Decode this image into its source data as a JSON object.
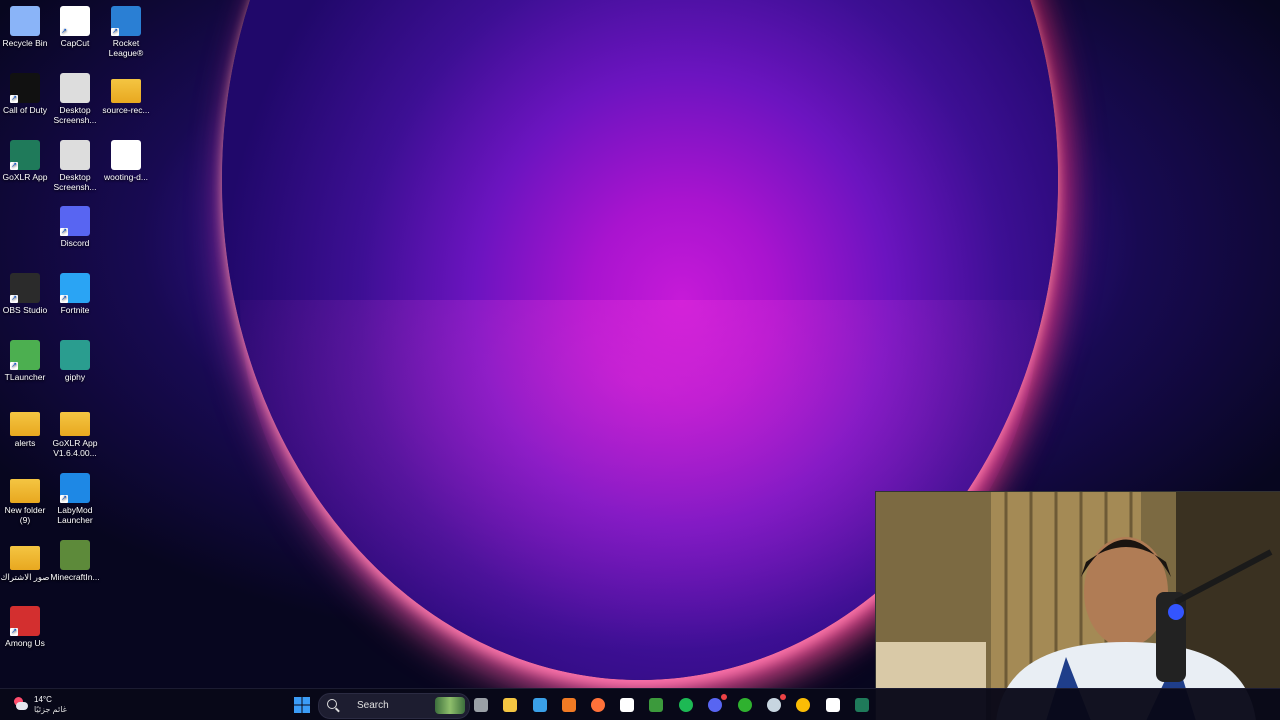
{
  "desktop": {
    "icons": [
      {
        "label": "Recycle Bin",
        "icon": "recycle-bin-icon",
        "color": "#8ab4f8",
        "shortcut": false
      },
      {
        "label": "CapCut",
        "icon": "capcut-icon",
        "color": "#ffffff",
        "shortcut": true
      },
      {
        "label": "Rocket League®",
        "icon": "rocket-league-icon",
        "color": "#2a7fd4",
        "shortcut": true
      },
      {
        "label": "Call of Duty",
        "icon": "call-of-duty-icon",
        "color": "#111111",
        "shortcut": true
      },
      {
        "label": "Desktop Screensh...",
        "icon": "screenshot-file-icon",
        "color": "#dddddd",
        "shortcut": false
      },
      {
        "label": "source-rec...",
        "icon": "folder-icon",
        "color": "#f4c542",
        "shortcut": false
      },
      {
        "label": "GoXLR App",
        "icon": "goxlr-icon",
        "color": "#1f7a5a",
        "shortcut": true
      },
      {
        "label": "Desktop Screensh...",
        "icon": "screenshot-file-icon",
        "color": "#dddddd",
        "shortcut": false
      },
      {
        "label": "wooting-d...",
        "icon": "wooting-icon",
        "color": "#ffffff",
        "shortcut": false
      },
      {
        "label": "Discord",
        "icon": "discord-icon",
        "color": "#5865f2",
        "shortcut": true
      },
      {
        "label": "OBS Studio",
        "icon": "obs-icon",
        "color": "#2b2b2b",
        "shortcut": true
      },
      {
        "label": "Fortnite",
        "icon": "fortnite-icon",
        "color": "#2aa4f4",
        "shortcut": true
      },
      {
        "label": "TLauncher",
        "icon": "tlauncher-icon",
        "color": "#4caf50",
        "shortcut": true
      },
      {
        "label": "giphy",
        "icon": "giphy-icon",
        "color": "#2a9d8f",
        "shortcut": false
      },
      {
        "label": "alerts",
        "icon": "folder-icon",
        "color": "#f4c542",
        "shortcut": false
      },
      {
        "label": "GoXLR App V1.6.4.00...",
        "icon": "folder-icon",
        "color": "#f4c542",
        "shortcut": false
      },
      {
        "label": "New folder (9)",
        "icon": "folder-icon",
        "color": "#f4c542",
        "shortcut": false
      },
      {
        "label": "LabyMod Launcher",
        "icon": "labymod-icon",
        "color": "#1e88e5",
        "shortcut": true
      },
      {
        "label": "صور الاشتراك",
        "icon": "folder-icon",
        "color": "#f4c542",
        "shortcut": false
      },
      {
        "label": "MinecraftIn...",
        "icon": "minecraft-icon",
        "color": "#5d8a3a",
        "shortcut": false
      },
      {
        "label": "Among Us",
        "icon": "among-us-icon",
        "color": "#d32f2f",
        "shortcut": true
      }
    ]
  },
  "taskbar": {
    "weather": {
      "temp": "14°C",
      "condition": "غائم جزئيًا",
      "icon": "weather-cloud-icon"
    },
    "search_label": "Search",
    "apps": [
      {
        "name": "start-button",
        "icon": "windows-start-icon",
        "color": "#3b9cf7"
      },
      {
        "name": "task-view-button",
        "icon": "task-view-icon",
        "color": "#9aa0a6"
      },
      {
        "name": "file-explorer-button",
        "icon": "file-explorer-icon",
        "color": "#f4c542"
      },
      {
        "name": "copilot-button",
        "icon": "copilot-icon",
        "color": "#3aa0e8"
      },
      {
        "name": "app-orange-button",
        "icon": "orange-app-icon",
        "color": "#f07a24"
      },
      {
        "name": "firefox-button",
        "icon": "firefox-icon",
        "color": "#ff7139"
      },
      {
        "name": "wooting-button",
        "icon": "wooting-icon",
        "color": "#ffffff"
      },
      {
        "name": "minecraft-launcher-button",
        "icon": "minecraft-icon",
        "color": "#3c9a3c"
      },
      {
        "name": "spotify-button",
        "icon": "spotify-icon",
        "color": "#1db954"
      },
      {
        "name": "discord-button",
        "icon": "discord-icon",
        "color": "#5865f2"
      },
      {
        "name": "xbox-button",
        "icon": "xbox-icon",
        "color": "#2fb12f"
      },
      {
        "name": "steam-button",
        "icon": "steam-icon",
        "color": "#c7d5e0"
      },
      {
        "name": "chrome-button",
        "icon": "chrome-icon",
        "color": "#fbbc05"
      },
      {
        "name": "capcut-button",
        "icon": "capcut-icon",
        "color": "#ffffff"
      },
      {
        "name": "goxlr-button",
        "icon": "goxlr-icon",
        "color": "#1f7a5a"
      }
    ]
  },
  "webcam": {
    "icon": "webcam-overlay-icon"
  }
}
